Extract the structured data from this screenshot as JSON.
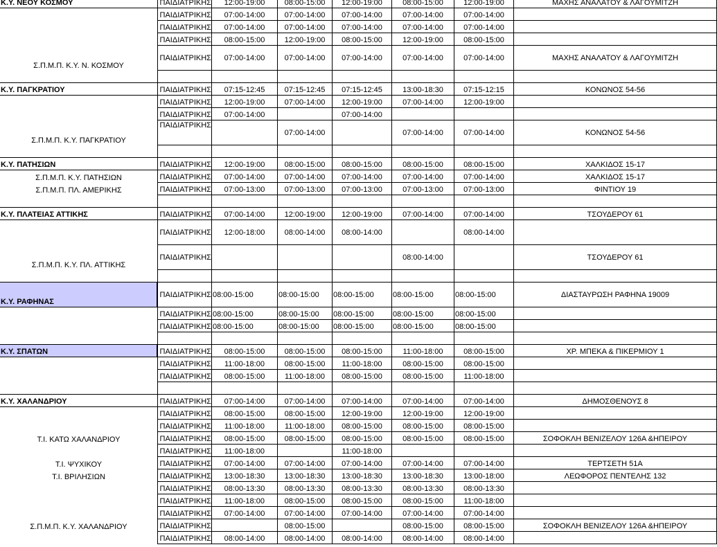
{
  "sheet": {
    "columns": [
      "unit",
      "specialty",
      "mon",
      "tue",
      "wed",
      "thu",
      "fri",
      "address"
    ],
    "rows": [
      {
        "h": 18,
        "unit": "Κ.Υ. ΝΕΟΥ ΚΟΣΜΟΥ",
        "unit_style": "group",
        "spec": "ΠΑΙΔΙΑΤΡΙΚΗΣ",
        "days": [
          "12:00-19:00",
          "08:00-15:00",
          "12:00-19:00",
          "08:00-15:00",
          "12:00-19:00"
        ],
        "addr": "ΜΑΧΗΣ ΑΝΑΛΑΤΟΥ & ΛΑΓΟΥΜΙΤΖΗ"
      },
      {
        "h": 18,
        "unit": "",
        "spec": "ΠΑΙΔΙΑΤΡΙΚΗΣ",
        "days": [
          "07:00-14:00",
          "07:00-14:00",
          "07:00-14:00",
          "07:00-14:00",
          "07:00-14:00"
        ],
        "addr": ""
      },
      {
        "h": 18,
        "unit": "",
        "spec": "ΠΑΙΔΙΑΤΡΙΚΗΣ",
        "days": [
          "07:00-14:00",
          "07:00-14:00",
          "07:00-14:00",
          "07:00-14:00",
          "07:00-14:00"
        ],
        "addr": ""
      },
      {
        "h": 18,
        "unit": "",
        "spec": "ΠΑΙΔΙΑΤΡΙΚΗΣ",
        "days": [
          "08:00-15:00",
          "12:00-19:00",
          "08:00-15:00",
          "12:00-19:00",
          "08:00-15:00"
        ],
        "addr": ""
      },
      {
        "h": 36,
        "unit": "Σ.Π.Μ.Π. Κ.Υ. Ν. ΚΟΣΜΟΥ",
        "unit_style": "sub",
        "spec": "ΠΑΙΔΙΑΤΡΙΚΗΣ",
        "days": [
          "07:00-14:00",
          "07:00-14:00",
          "07:00-14:00",
          "07:00-14:00",
          "07:00-14:00"
        ],
        "addr": "ΜΑΧΗΣ ΑΝΑΛΑΤΟΥ & ΛΑΓΟΥΜΙΤΖΗ",
        "valign": "middle"
      },
      {
        "h": 18,
        "blank": true
      },
      {
        "h": 18,
        "unit": "Κ.Υ. ΠΑΓΚΡΑΤΙΟΥ",
        "unit_style": "group",
        "spec": "ΠΑΙΔΙΑΤΡΙΚΗΣ",
        "days": [
          "07:15-12:45",
          "07:15-12:45",
          "07:15-12:45",
          "13:00-18:30",
          "07:15-12:15"
        ],
        "addr": "ΚΟΝΩΝΟΣ 54-56"
      },
      {
        "h": 18,
        "unit": "",
        "spec": "ΠΑΙΔΙΑΤΡΙΚΗΣ",
        "days": [
          "12:00-19:00",
          "07:00-14:00",
          "12:00-19:00",
          "07:00-14:00",
          "12:00-19:00"
        ],
        "addr": ""
      },
      {
        "h": 18,
        "unit": "",
        "spec": "ΠΑΙΔΙΑΤΡΙΚΗΣ",
        "days": [
          "07:00-14:00",
          "",
          "07:00-14:00",
          "",
          ""
        ],
        "addr": ""
      },
      {
        "h": 36,
        "unit": "Σ.Π.Μ.Π. Κ.Υ. ΠΑΓΚΡΑΤΙΟΥ",
        "unit_style": "sub",
        "spec": "ΠΑΙΔΙΑΤΡΙΚΗΣ",
        "spec_valign": "top",
        "days": [
          "",
          "07:00-14:00",
          "",
          "07:00-14:00",
          "07:00-14:00"
        ],
        "addr": "ΚΟΝΩΝΟΣ 54-56",
        "valign": "middle"
      },
      {
        "h": 18,
        "blank": true
      },
      {
        "h": 18,
        "unit": "Κ.Υ. ΠΑΤΗΣΙΩΝ",
        "unit_style": "group",
        "spec": "ΠΑΙΔΙΑΤΡΙΚΗΣ",
        "days": [
          "12:00-19:00",
          "08:00-15:00",
          "08:00-15:00",
          "08:00-15:00",
          "08:00-15:00"
        ],
        "addr": "ΧΑΛΚΙΔΟΣ 15-17"
      },
      {
        "h": 18,
        "unit": "Σ.Π.Μ.Π. Κ.Υ. ΠΑΤΗΣΙΩΝ",
        "unit_style": "sub",
        "spec": "ΠΑΙΔΙΑΤΡΙΚΗΣ",
        "days": [
          "07:00-14:00",
          "07:00-14:00",
          "07:00-14:00",
          "07:00-14:00",
          "07:00-14:00"
        ],
        "addr": "ΧΑΛΚΙΔΟΣ 15-17"
      },
      {
        "h": 18,
        "unit": "Σ.Π.Μ.Π. ΠΛ. ΑΜΕΡΙΚΗΣ",
        "unit_style": "sub",
        "spec": "ΠΑΙΔΙΑΤΡΙΚΗΣ",
        "days": [
          "07:00-13:00",
          "07:00-13:00",
          "07:00-13:00",
          "07:00-13:00",
          "07:00-13:00"
        ],
        "addr": "ΦΙΝΤΙΟΥ 19"
      },
      {
        "h": 18,
        "blank": true
      },
      {
        "h": 18,
        "unit": "Κ.Υ. ΠΛΑΤΕΙΑΣ ΑΤΤΙΚΗΣ",
        "unit_style": "group",
        "spec": "ΠΑΙΔΙΑΤΡΙΚΗΣ",
        "days": [
          "07:00-14:00",
          "12:00-19:00",
          "12:00-19:00",
          "07:00-14:00",
          "07:00-14:00"
        ],
        "addr": "ΤΣΟΥΔΕΡΟΥ 61"
      },
      {
        "h": 36,
        "unit": "",
        "spec": "ΠΑΙΔΙΑΤΡΙΚΗΣ",
        "days": [
          "12:00-18:00",
          "08:00-14:00",
          "08:00-14:00",
          "",
          "08:00-14:00"
        ],
        "addr": "",
        "valign": "middle"
      },
      {
        "h": 36,
        "unit": "Σ.Π.Μ.Π. Κ.Υ. ΠΛ. ΑΤΤΙΚΗΣ",
        "unit_style": "sub",
        "spec": "ΠΑΙΔΙΑΤΡΙΚΗΣ",
        "days": [
          "",
          "",
          "",
          "08:00-14:00",
          ""
        ],
        "addr": "ΤΣΟΥΔΕΡΟΥ 61",
        "valign": "middle"
      },
      {
        "h": 18,
        "blank": true
      },
      {
        "h": 36,
        "unit": "Κ.Υ. ΡΑΦΗΝΑΣ",
        "unit_style": "group",
        "highlight": true,
        "spec": "ΠΑΙΔΙΑΤΡΙΚΗΣ",
        "days": [
          "08:00-15:00",
          "08:00-15:00",
          "08:00-15:00",
          "08:00-15:00",
          "08:00-15:00"
        ],
        "days_align": "left",
        "addr": "ΔΙΑΣΤΑΥΡΩΣΗ ΡΑΦΗΝΑ 19009",
        "valign": "middle"
      },
      {
        "h": 18,
        "unit": "",
        "spec": "ΠΑΙΔΙΑΤΡΙΚΗΣ",
        "days": [
          "08:00-15:00",
          "08:00-15:00",
          "08:00-15:00",
          "08:00-15:00",
          "08:00-15:00"
        ],
        "days_align": "left",
        "addr": ""
      },
      {
        "h": 18,
        "unit": "",
        "spec": "ΠΑΙΔΙΑΤΡΙΚΗΣ",
        "days": [
          "08:00-15:00",
          "08:00-15:00",
          "08:00-15:00",
          "08:00-15:00",
          "08:00-15:00"
        ],
        "days_align": "left",
        "addr": ""
      },
      {
        "h": 18,
        "blank": true
      },
      {
        "h": 18,
        "unit": "Κ.Υ. ΣΠΑΤΩΝ",
        "unit_style": "group",
        "highlight": true,
        "spec": "ΠΑΙΔΙΑΤΡΙΚΗΣ",
        "days": [
          "08:00-15:00",
          "08:00-15:00",
          "08:00-15:00",
          "11:00-18:00",
          "08:00-15:00"
        ],
        "addr": "ΧΡ. ΜΠΕΚΑ & ΠΙΚΕΡΜΙΟΥ 1"
      },
      {
        "h": 18,
        "unit": "",
        "spec": "ΠΑΙΔΙΑΤΡΙΚΗΣ",
        "days": [
          "11:00-18:00",
          "08:00-15:00",
          "11:00-18:00",
          "08:00-15:00",
          "08:00-15:00"
        ],
        "addr": ""
      },
      {
        "h": 18,
        "unit": "",
        "spec": "ΠΑΙΔΙΑΤΡΙΚΗΣ",
        "days": [
          "08:00-15:00",
          "11:00-18:00",
          "08:00-15:00",
          "08:00-15:00",
          "11:00-18:00"
        ],
        "addr": ""
      },
      {
        "h": 18,
        "blank": true
      },
      {
        "h": 18,
        "unit": "Κ.Υ. ΧΑΛΑΝΔΡΙΟΥ",
        "unit_style": "group",
        "spec": "ΠΑΙΔΙΑΤΡΙΚΗΣ",
        "days": [
          "07:00-14:00",
          "07:00-14:00",
          "07:00-14:00",
          "07:00-14:00",
          "07:00-14:00"
        ],
        "addr": "ΔΗΜΟΣΘΕΝΟΥΣ 8"
      },
      {
        "h": 18,
        "unit": "",
        "spec": "ΠΑΙΔΙΑΤΡΙΚΗΣ",
        "days": [
          "08:00-15:00",
          "08:00-15:00",
          "12:00-19:00",
          "12:00-19:00",
          "12:00-19:00"
        ],
        "addr": ""
      },
      {
        "h": 18,
        "unit": "",
        "spec": "ΠΑΙΔΙΑΤΡΙΚΗΣ",
        "days": [
          "11:00-18:00",
          "11:00-18:00",
          "08:00-15:00",
          "08:00-15:00",
          "08:00-15:00"
        ],
        "addr": ""
      },
      {
        "h": 18,
        "unit": "Τ.Ι. ΚΑΤΩ ΧΑΛΑΝΔΡΙΟΥ",
        "unit_style": "sub",
        "spec": "ΠΑΙΔΙΑΤΡΙΚΗΣ",
        "days": [
          "08:00-15:00",
          "08:00-15:00",
          "08:00-15:00",
          "08:00-15:00",
          "08:00-15:00"
        ],
        "addr": "ΣΟΦΟΚΛΗ ΒΕΝΙΖΕΛΟΥ 126Α &ΗΠΕΙΡΟΥ"
      },
      {
        "h": 18,
        "unit": "",
        "spec": "ΠΑΙΔΙΑΤΡΙΚΗΣ",
        "days": [
          "11:00-18:00",
          "",
          "11:00-18:00",
          "",
          ""
        ],
        "addr": ""
      },
      {
        "h": 18,
        "unit": "Τ.Ι. ΨΥΧΙΚΟΥ",
        "unit_style": "sub",
        "spec": "ΠΑΙΔΙΑΤΡΙΚΗΣ",
        "days": [
          "07:00-14:00",
          "07:00-14:00",
          "07:00-14:00",
          "07:00-14:00",
          "07:00-14:00"
        ],
        "addr": "ΤΕΡΤΣΕΤΗ 51Α"
      },
      {
        "h": 18,
        "unit": "Τ.Ι. ΒΡΙΛΗΣΙΩΝ",
        "unit_style": "sub",
        "spec": "ΠΑΙΔΙΑΤΡΙΚΗΣ",
        "days": [
          "13:00-18:30",
          "13:00-18:30",
          "13:00-18:30",
          "13:00-18:30",
          "13:00-18:00"
        ],
        "addr": "ΛΕΩΦΟΡΟΣ ΠΕΝΤΕΛΗΣ 132"
      },
      {
        "h": 18,
        "unit": "",
        "spec": "ΠΑΙΔΙΑΤΡΙΚΗΣ",
        "days": [
          "08:00-13:30",
          "08:00-13:30",
          "08:00-13:30",
          "08:00-13:30",
          "08:00-13:30"
        ],
        "addr": ""
      },
      {
        "h": 18,
        "unit": "",
        "spec": "ΠΑΙΔΙΑΤΡΙΚΗΣ",
        "days": [
          "11:00-18:00",
          "08:00-15:00",
          "08:00-15:00",
          "08:00-15:00",
          "11:00-18:00"
        ],
        "addr": ""
      },
      {
        "h": 18,
        "unit": "",
        "spec": "ΠΑΙΔΙΑΤΡΙΚΗΣ",
        "days": [
          "07:00-14:00",
          "07:00-14:00",
          "07:00-14:00",
          "07:00-14:00",
          "07:00-14:00"
        ],
        "addr": ""
      },
      {
        "h": 18,
        "unit": "Σ.Π.Μ.Π. Κ.Υ. ΧΑΛΑΝΔΡΙΟΥ",
        "unit_style": "sub",
        "spec": "ΠΑΙΔΙΑΤΡΙΚΗΣ",
        "days": [
          "",
          "08:00-15:00",
          "",
          "08:00-15:00",
          "08:00-15:00"
        ],
        "addr": "ΣΟΦΟΚΛΗ ΒΕΝΙΖΕΛΟΥ 126Α &ΗΠΕΙΡΟΥ"
      },
      {
        "h": 18,
        "unit": "",
        "spec": "ΠΑΙΔΙΑΤΡΙΚΗΣ",
        "days": [
          "08:00-14:00",
          "08:00-14:00",
          "08:00-14:00",
          "08:00-14:00",
          "08:00-14:00"
        ],
        "addr": ""
      }
    ]
  }
}
